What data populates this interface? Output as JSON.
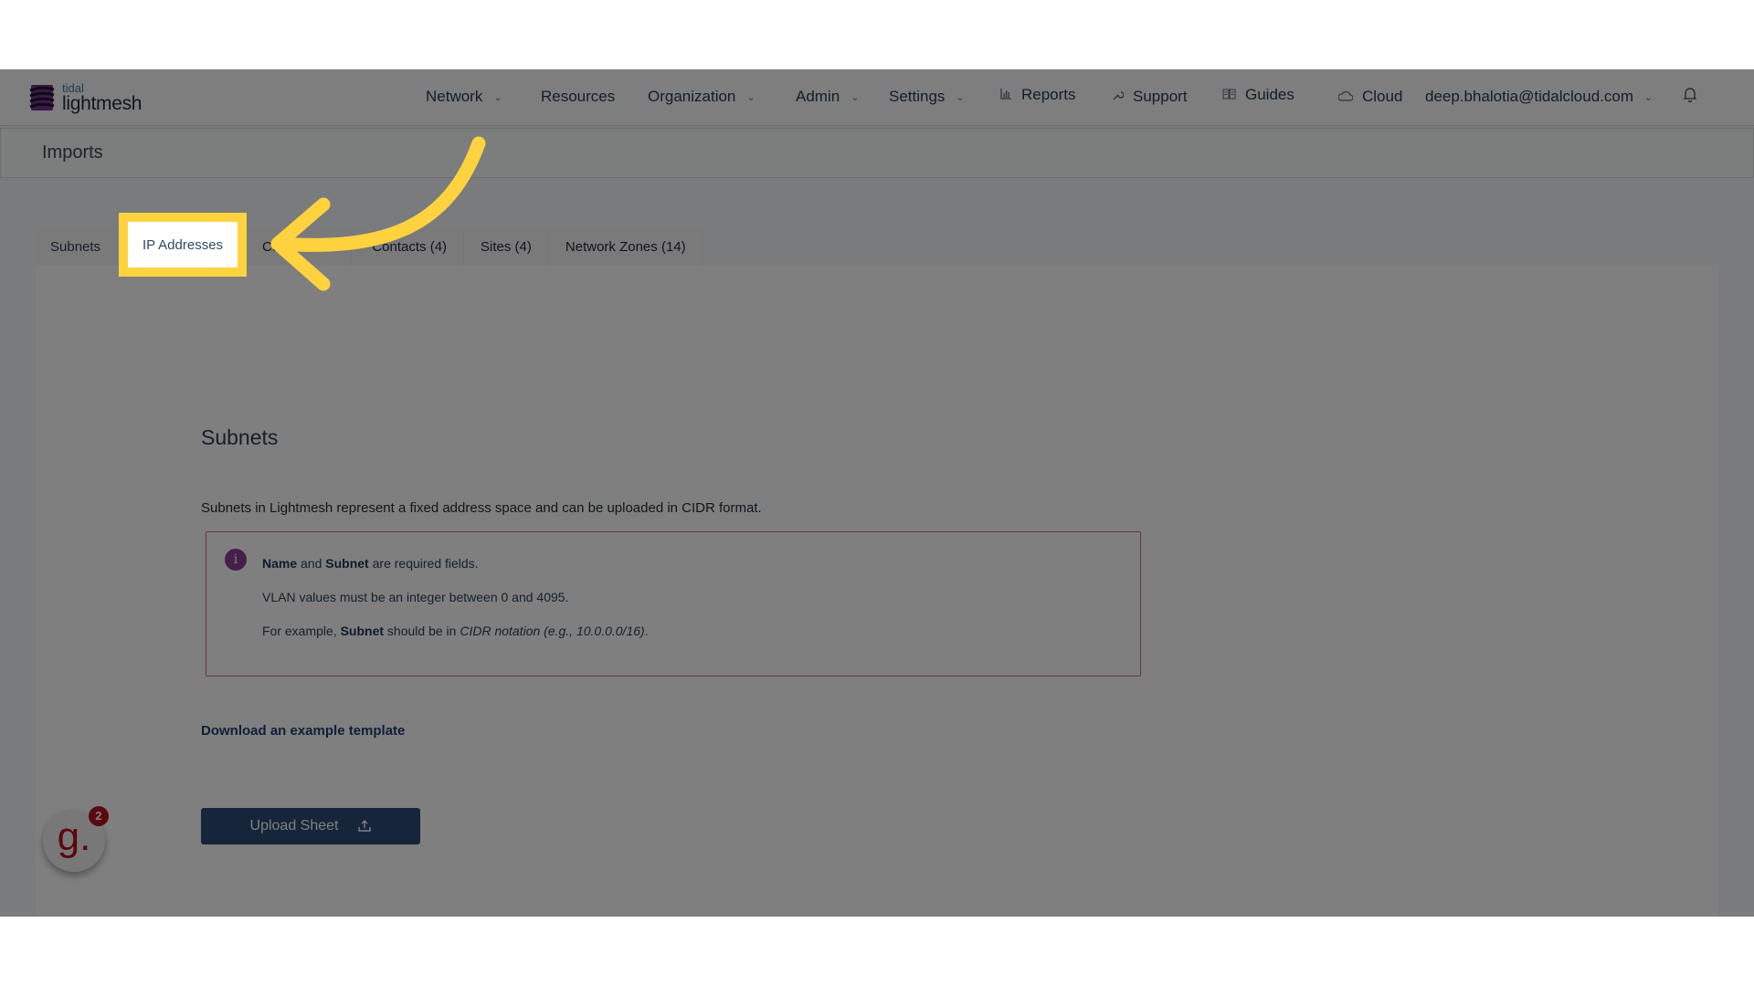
{
  "header": {
    "logo_small": "tidal",
    "logo_big": "lightmesh",
    "nav": [
      {
        "label": "Network",
        "dropdown": true
      },
      {
        "label": "Resources",
        "dropdown": false
      },
      {
        "label": "Organization",
        "dropdown": true
      },
      {
        "label": "Admin",
        "dropdown": true
      },
      {
        "label": "Settings",
        "dropdown": true
      },
      {
        "label": "Reports",
        "icon": "bar-chart-icon"
      },
      {
        "label": "Support",
        "icon": "wrench-icon"
      },
      {
        "label": "Guides",
        "icon": "book-icon"
      },
      {
        "label": "Cloud",
        "icon": "cloud-icon"
      }
    ],
    "user_email": "deep.bhalotia@tidalcloud.com",
    "chevron": "⌄",
    "bell_icon": "bell-icon"
  },
  "page": {
    "title": "Imports"
  },
  "tabs": [
    {
      "label": "Subnets"
    },
    {
      "label": "IP Addresses",
      "highlighted": true
    },
    {
      "label": "Cu"
    },
    {
      "label": "Contacts (4)"
    },
    {
      "label": "Sites (4)"
    },
    {
      "label": "Network Zones (14)"
    }
  ],
  "content": {
    "section_title": "Subnets",
    "description": "Subnets in Lightmesh represent a fixed address space and can be uploaded in CIDR format.",
    "info": {
      "icon": "i",
      "line1": {
        "b1": "Name",
        "t1": " and ",
        "b2": "Subnet",
        "t2": " are required fields."
      },
      "line2": "VLAN values must be an integer between 0 and 4095.",
      "line3": {
        "t1": "For example, ",
        "b1": "Subnet",
        "t2": " should be in ",
        "i1": "CIDR notation (e.g., 10.0.0.0/16)",
        "t3": "."
      }
    },
    "download_link": "Download an example template",
    "upload_button": "Upload Sheet",
    "upload_icon": "⇪"
  },
  "chat_widget": {
    "glyph": "g.",
    "badge_count": "2"
  },
  "colors": {
    "highlight": "#ffd23f",
    "primary_button": "#2c4b74",
    "info_icon": "#8a3f93",
    "chat_brand": "#b5121b"
  }
}
